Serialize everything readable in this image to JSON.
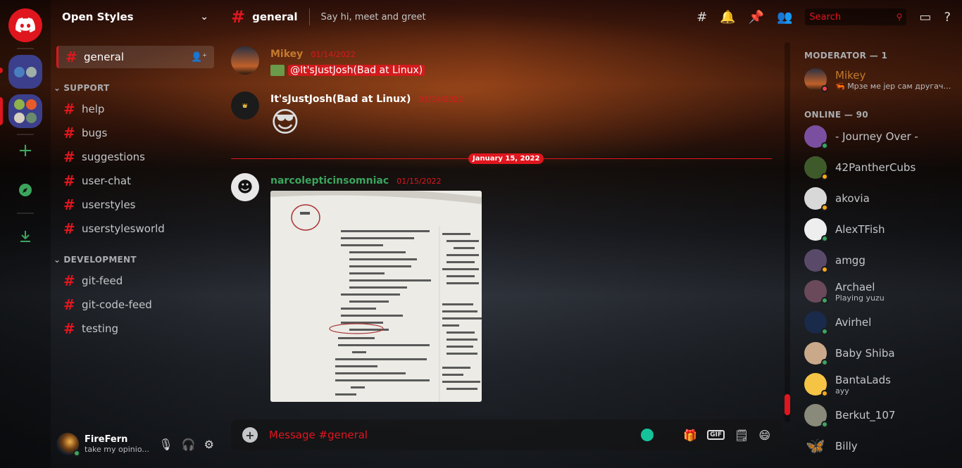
{
  "server": {
    "name": "Open Styles"
  },
  "channels": {
    "active": "general",
    "categories": [
      {
        "label": "SUPPORT",
        "items": [
          "help",
          "bugs",
          "suggestions",
          "user-chat",
          "userstyles",
          "userstylesworld"
        ]
      },
      {
        "label": "DEVELOPMENT",
        "items": [
          "git-feed",
          "git-code-feed",
          "testing"
        ]
      }
    ]
  },
  "user": {
    "name": "FireFern",
    "status": "take my opinio..."
  },
  "header": {
    "channel": "general",
    "topic": "Say hi, meet and greet",
    "search_placeholder": "Search"
  },
  "messages": [
    {
      "author": "Mikey",
      "date": "01/14/2022",
      "mention": "@It'sJustJosh(Bad at Linux)"
    },
    {
      "author": "It'sJustJosh(Bad at Linux)",
      "date": "01/14/2022",
      "emoji": "😎"
    },
    {
      "author": "narcolepticinsomniac",
      "date": "01/15/2022",
      "attachment": "photo of book index page"
    }
  ],
  "date_divider": "January 15, 2022",
  "composer": {
    "placeholder": "Message #general"
  },
  "members": {
    "moderator_label": "MODERATOR — 1",
    "moderators": [
      {
        "name": "Mikey",
        "sub": "🦐 Мрзе ме јер сам другачиј..."
      }
    ],
    "online_label": "ONLINE — 90",
    "online": [
      {
        "name": "- Journey Over -",
        "sub": ""
      },
      {
        "name": "42PantherCubs",
        "sub": ""
      },
      {
        "name": "akovia",
        "sub": ""
      },
      {
        "name": "AlexTFish",
        "sub": ""
      },
      {
        "name": "amgg",
        "sub": ""
      },
      {
        "name": "Archael",
        "sub": "Playing yuzu"
      },
      {
        "name": "Avirhel",
        "sub": ""
      },
      {
        "name": "Baby Shiba",
        "sub": ""
      },
      {
        "name": "BantaLads",
        "sub": "ayy"
      },
      {
        "name": "Berkut_107",
        "sub": ""
      },
      {
        "name": "Billy",
        "sub": ""
      }
    ]
  },
  "colors": {
    "accent": "#e0161e",
    "online": "#3ba55d",
    "idle": "#faa81a",
    "dnd": "#ed4245"
  }
}
